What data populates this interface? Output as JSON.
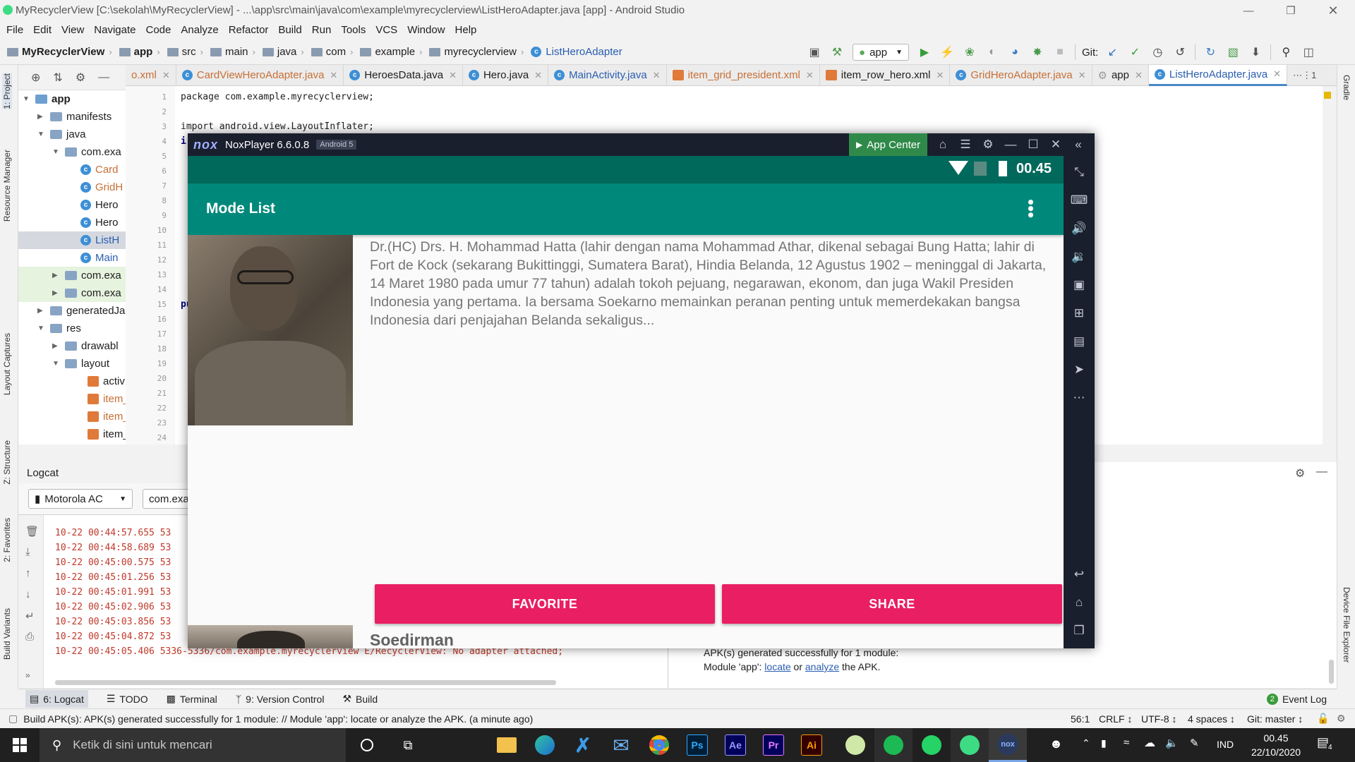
{
  "window": {
    "title": "MyRecyclerView [C:\\sekolah\\MyRecyclerView] - ...\\app\\src\\main\\java\\com\\example\\myrecyclerview\\ListHeroAdapter.java [app] - Android Studio"
  },
  "menu": [
    "File",
    "Edit",
    "View",
    "Navigate",
    "Code",
    "Analyze",
    "Refactor",
    "Build",
    "Run",
    "Tools",
    "VCS",
    "Window",
    "Help"
  ],
  "breadcrumb": [
    "MyRecyclerView",
    "app",
    "src",
    "main",
    "java",
    "com",
    "example",
    "myrecyclerview",
    "ListHeroAdapter"
  ],
  "toolbar": {
    "run_config": "app",
    "git_label": "Git:"
  },
  "tabs": [
    {
      "label": "o.xml",
      "active": false
    },
    {
      "label": "CardViewHeroAdapter.java",
      "active": false
    },
    {
      "label": "HeroesData.java",
      "active": false
    },
    {
      "label": "Hero.java",
      "active": false
    },
    {
      "label": "MainActivity.java",
      "active": false
    },
    {
      "label": "item_grid_president.xml",
      "active": false
    },
    {
      "label": "item_row_hero.xml",
      "active": false
    },
    {
      "label": "GridHeroAdapter.java",
      "active": false
    },
    {
      "label": "app",
      "active": false
    },
    {
      "label": "ListHeroAdapter.java",
      "active": true
    }
  ],
  "tab_menu": "⋯⋮1",
  "side_labels": {
    "project": "1: Project",
    "resource_manager": "Resource Manager",
    "layout_captures": "Layout Captures",
    "structure": "Z: Structure",
    "favorites": "2: Favorites",
    "build_variants": "Build Variants",
    "gradle": "Gradle",
    "device_file_explorer": "Device File Explorer"
  },
  "project_tree": [
    {
      "label": "app",
      "depth": 0,
      "type": "module",
      "bold": true
    },
    {
      "label": "manifests",
      "depth": 1,
      "type": "folder"
    },
    {
      "label": "java",
      "depth": 1,
      "type": "folder"
    },
    {
      "label": "com.exa",
      "depth": 2,
      "type": "package"
    },
    {
      "label": "Card",
      "depth": 3,
      "type": "class"
    },
    {
      "label": "GridH",
      "depth": 3,
      "type": "class"
    },
    {
      "label": "Hero",
      "depth": 3,
      "type": "class"
    },
    {
      "label": "Hero",
      "depth": 3,
      "type": "class"
    },
    {
      "label": "ListH",
      "depth": 3,
      "type": "class",
      "selected": true
    },
    {
      "label": "Main",
      "depth": 3,
      "type": "class"
    },
    {
      "label": "com.exa",
      "depth": 2,
      "type": "package"
    },
    {
      "label": "com.exa",
      "depth": 2,
      "type": "package"
    },
    {
      "label": "generatedJa",
      "depth": 1,
      "type": "folder"
    },
    {
      "label": "res",
      "depth": 1,
      "type": "folder"
    },
    {
      "label": "drawabl",
      "depth": 2,
      "type": "folder"
    },
    {
      "label": "layout",
      "depth": 2,
      "type": "folder"
    },
    {
      "label": "activ",
      "depth": 3,
      "type": "xml"
    },
    {
      "label": "item_",
      "depth": 3,
      "type": "xml"
    },
    {
      "label": "item_",
      "depth": 3,
      "type": "xml"
    },
    {
      "label": "item_",
      "depth": 3,
      "type": "xml"
    },
    {
      "label": "menu",
      "depth": 2,
      "type": "folder"
    }
  ],
  "line_numbers": [
    "1",
    "2",
    "3",
    "4",
    "5",
    "6",
    "7",
    "8",
    "9",
    "10",
    "11",
    "12",
    "13",
    "14",
    "15",
    "16",
    "17",
    "18",
    "19",
    "20",
    "21",
    "22",
    "23",
    "24"
  ],
  "code": {
    "line1": "package com.example.myrecyclerview;",
    "line3": "import android.view.LayoutInflater;",
    "i": "i",
    "pu": "pu",
    "l": "L"
  },
  "logcat": {
    "title": "Logcat",
    "device": "Motorola AC",
    "package": "com.exa",
    "lines": [
      "10-22 00:44:57.655 53",
      "10-22 00:44:58.689 53",
      "10-22 00:45:00.575 53",
      "10-22 00:45:01.256 53",
      "10-22 00:45:01.991 53",
      "10-22 00:45:02.906 53",
      "10-22 00:45:03.856 53",
      "10-22 00:45:04.872 53",
      "10-22 00:45:05.406 5336-5336/com.example.myrecyclerview E/RecyclerView: No adapter attached;"
    ]
  },
  "build_output": {
    "line1": "APK(s) generated successfully for 1 module:",
    "line2_prefix": "Module 'app':",
    "link_locate": "locate",
    "line2_mid": "or",
    "link_analyze": "analyze",
    "line2_suffix": "the APK."
  },
  "bottom_tabs": [
    "6: Logcat",
    "TODO",
    "Terminal",
    "9: Version Control",
    "Build"
  ],
  "event_log": {
    "count": "2",
    "label": "Event Log"
  },
  "status": {
    "message": "Build APK(s): APK(s) generated successfully for 1 module: // Module 'app': locate or analyze the APK. (a minute ago)",
    "position": "56:1",
    "line_sep": "CRLF ↕",
    "encoding": "UTF-8 ↕",
    "indent": "4 spaces ↕",
    "git": "Git: master ↕"
  },
  "nox": {
    "brand": "nox",
    "title": "NoxPlayer 6.6.0.8",
    "android_badge": "Android 5",
    "app_center": "App Center",
    "clock": "00.45",
    "app_title": "Mode List",
    "description": "Dr.(HC) Drs. H. Mohammad Hatta (lahir dengan nama Mohammad Athar, dikenal sebagai Bung Hatta; lahir di Fort de Kock (sekarang Bukittinggi, Sumatera Barat), Hindia Belanda, 12 Agustus 1902 – meninggal di Jakarta, 14 Maret 1980 pada umur 77 tahun) adalah tokoh pejuang, negarawan, ekonom, dan juga Wakil Presiden Indonesia yang pertama. Ia bersama Soekarno memainkan peranan penting untuk memerdekakan bangsa Indonesia dari penjajahan Belanda sekaligus...",
    "favorite_button": "FAVORITE",
    "share_button": "SHARE",
    "next_name": "Soedirman"
  },
  "taskbar": {
    "search_placeholder": "Ketik di sini untuk mencari",
    "apps": [
      "Ps",
      "Ae",
      "Pr",
      "Ai"
    ],
    "lang": "IND",
    "time": "00.45",
    "date": "22/10/2020",
    "notif_count": "4"
  },
  "colors": {
    "teal_dark": "#00695c",
    "teal": "#00897b",
    "pink": "#e91e63",
    "nox_dark": "#1a1f2e",
    "link": "#2a5db0",
    "log_error": "#c0392b"
  }
}
